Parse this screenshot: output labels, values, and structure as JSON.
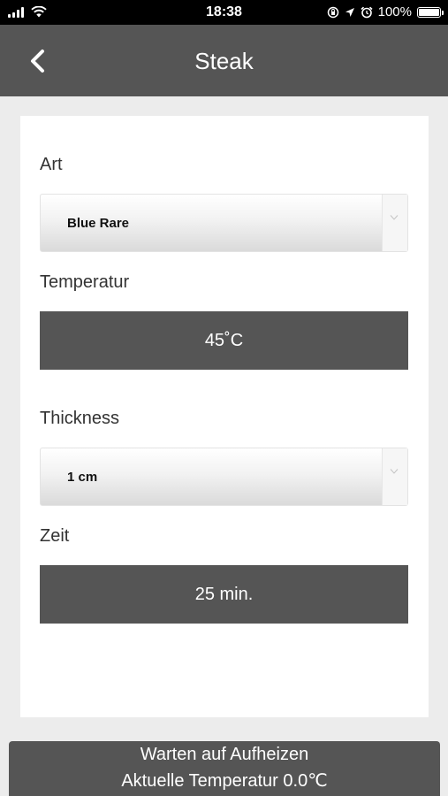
{
  "status_bar": {
    "time": "18:38",
    "battery": "100%"
  },
  "header": {
    "title": "Steak"
  },
  "form": {
    "art": {
      "label": "Art",
      "selected": "Blue Rare"
    },
    "temperatur": {
      "label": "Temperatur",
      "value": "45˚C"
    },
    "thickness": {
      "label": "Thickness",
      "selected": "1 cm"
    },
    "zeit": {
      "label": "Zeit",
      "value": "25 min."
    }
  },
  "footer": {
    "line1": "Warten auf Aufheizen",
    "line2": "Aktuelle Temperatur 0.0℃"
  }
}
